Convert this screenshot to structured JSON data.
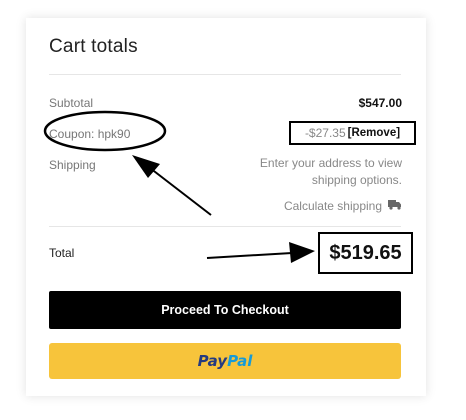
{
  "cart": {
    "title": "Cart totals",
    "subtotal_label": "Subtotal",
    "subtotal_value": "$547.00",
    "coupon_label": "Coupon: hpk90",
    "coupon_discount": "-$27.35",
    "coupon_remove": "[Remove]",
    "shipping_label": "Shipping",
    "shipping_text": "Enter your address to view shipping options.",
    "calculate_shipping": "Calculate shipping",
    "total_label": "Total",
    "total_value": "$519.65"
  },
  "buttons": {
    "checkout": "Proceed To Checkout",
    "paypal_part1": "Pay",
    "paypal_part2": "Pal"
  },
  "icons": {
    "truck": "truck-icon"
  },
  "colors": {
    "checkout_bg": "#000000",
    "paypal_bg": "#f7c43b",
    "paypal_dark": "#253b80",
    "paypal_light": "#179bd7"
  }
}
